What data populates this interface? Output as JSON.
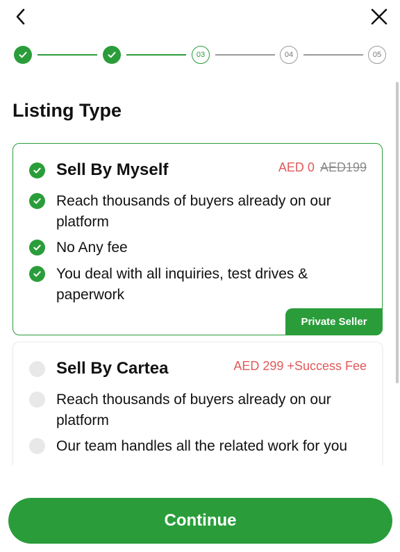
{
  "header": {
    "back_icon": "chevron-left-icon",
    "close_icon": "close-icon"
  },
  "stepper": {
    "steps": [
      {
        "label": "",
        "state": "done"
      },
      {
        "label": "",
        "state": "done"
      },
      {
        "label": "03",
        "state": "current"
      },
      {
        "label": "04",
        "state": "todo"
      },
      {
        "label": "05",
        "state": "todo"
      }
    ]
  },
  "page": {
    "title": "Listing Type"
  },
  "options": [
    {
      "title": "Sell By Myself",
      "price": "AED 0",
      "old_price": "AED199",
      "selected": true,
      "features": [
        "Reach thousands of buyers already on our platform",
        "No Any fee",
        "You deal with all inquiries, test drives & paperwork"
      ],
      "tag": "Private Seller"
    },
    {
      "title": "Sell By Cartea",
      "price": "AED 299 +Success Fee",
      "selected": false,
      "features": [
        "Reach thousands of buyers already on our platform",
        "Our team handles all the related work for you"
      ]
    }
  ],
  "footer": {
    "continue_label": "Continue"
  },
  "colors": {
    "accent": "#2a9d3a",
    "price": "#e05a5a",
    "muted": "#9a9a9a"
  }
}
